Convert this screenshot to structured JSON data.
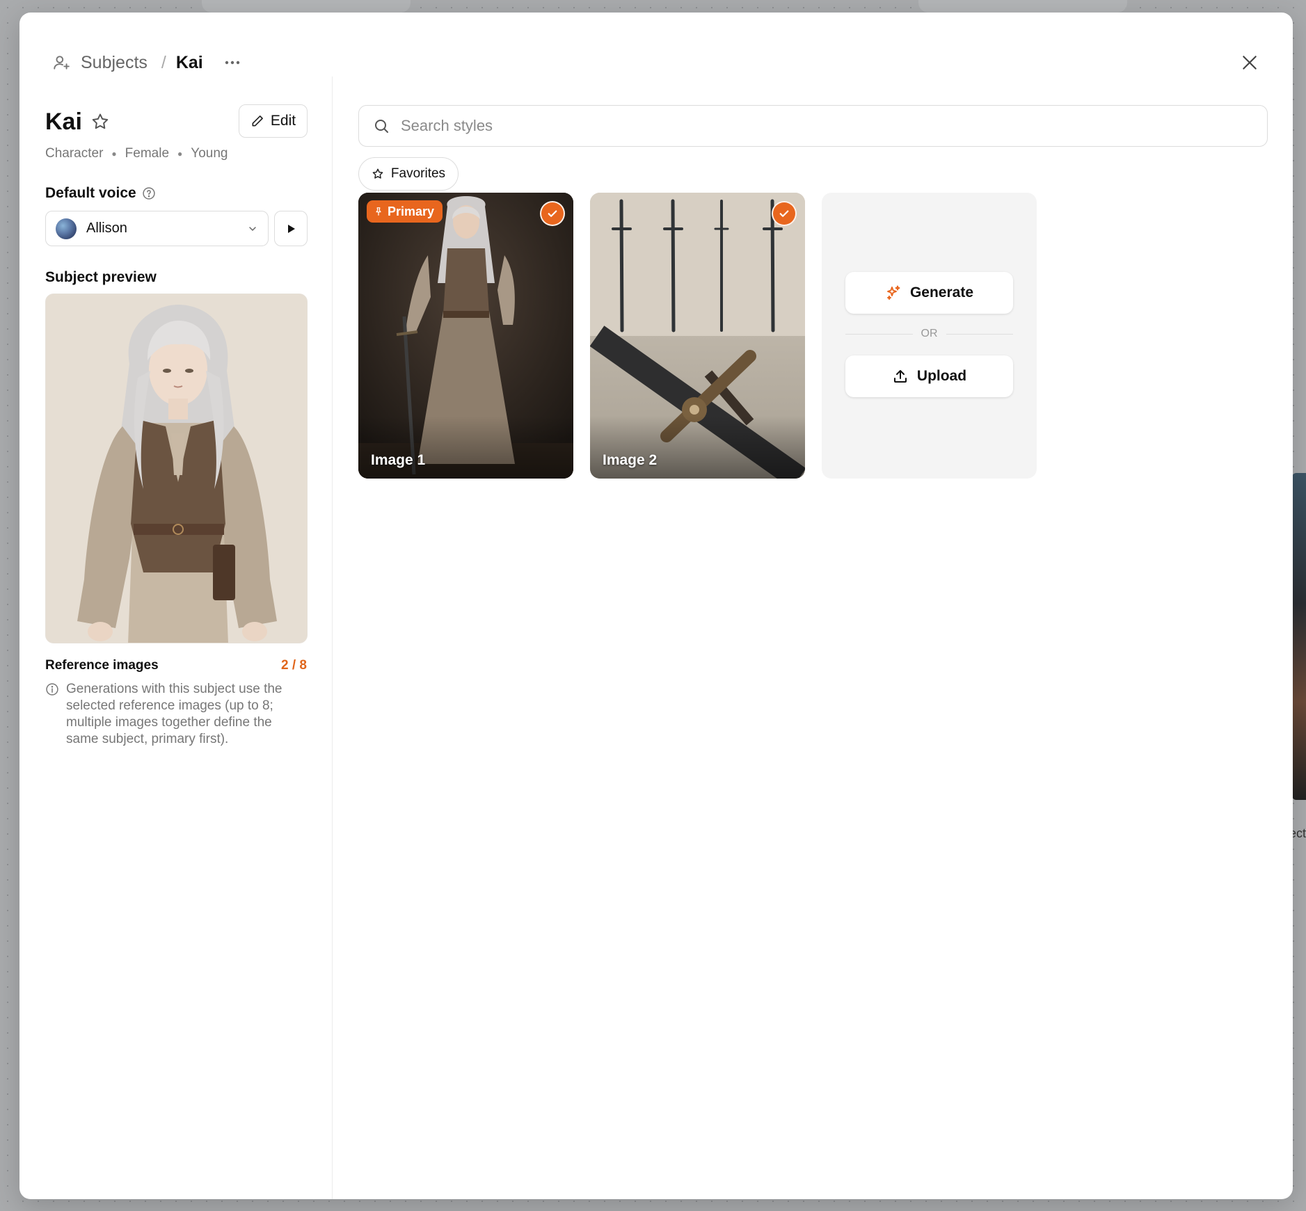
{
  "breadcrumb": {
    "root": "Subjects",
    "current": "Kai"
  },
  "subject": {
    "name": "Kai",
    "tags": [
      "Character",
      "Female",
      "Young"
    ],
    "edit_label": "Edit"
  },
  "voice": {
    "label": "Default voice",
    "selected": "Allison"
  },
  "preview": {
    "label": "Subject preview"
  },
  "reference": {
    "label": "Reference images",
    "count": "2 / 8",
    "info": "Generations with this subject use the selected reference images (up to 8; multiple images together define the same subject, primary first)."
  },
  "search": {
    "placeholder": "Search styles",
    "value": ""
  },
  "filters": {
    "favorites_label": "Favorites"
  },
  "images": [
    {
      "label": "Image 1",
      "badge": "Primary",
      "selected": true
    },
    {
      "label": "Image 2",
      "selected": true
    }
  ],
  "add": {
    "generate_label": "Generate",
    "or_label": "OR",
    "upload_label": "Upload"
  },
  "background": {
    "peek_text": "ect"
  },
  "colors": {
    "accent": "#e8661e",
    "count_color": "#e0661c"
  }
}
